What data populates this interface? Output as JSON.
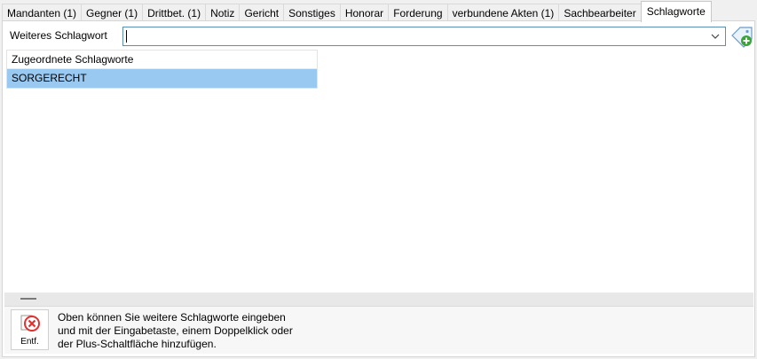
{
  "tabs": [
    {
      "label": "Mandanten (1)",
      "active": false
    },
    {
      "label": "Gegner (1)",
      "active": false
    },
    {
      "label": "Drittbet. (1)",
      "active": false
    },
    {
      "label": "Notiz",
      "active": false
    },
    {
      "label": "Gericht",
      "active": false
    },
    {
      "label": "Sonstiges",
      "active": false
    },
    {
      "label": "Honorar",
      "active": false
    },
    {
      "label": "Forderung",
      "active": false
    },
    {
      "label": "verbundene Akten (1)",
      "active": false
    },
    {
      "label": "Sachbearbeiter",
      "active": false
    },
    {
      "label": "Schlagworte",
      "active": true
    }
  ],
  "schlagwort": {
    "label": "Weiteres Schlagwort",
    "value": "",
    "dropdown_icon": "chevron-down-icon",
    "add_icon": "tag-plus-icon"
  },
  "list": {
    "header": "Zugeordnete Schlagworte",
    "items": [
      {
        "label": "SORGERECHT",
        "selected": true
      }
    ]
  },
  "bottom": {
    "delete_label": "Entf.",
    "delete_icon": "delete-x-icon",
    "hint_lines": [
      "Oben können Sie weitere Schlagworte eingeben",
      "und mit der Eingabetaste, einem Doppelklick oder",
      "der Plus-Schaltfläche hinzufügen."
    ]
  },
  "colors": {
    "selection": "#99c9f0",
    "input_border": "#5a8fb8",
    "delete_red": "#e03030",
    "add_green": "#3aa33a"
  }
}
